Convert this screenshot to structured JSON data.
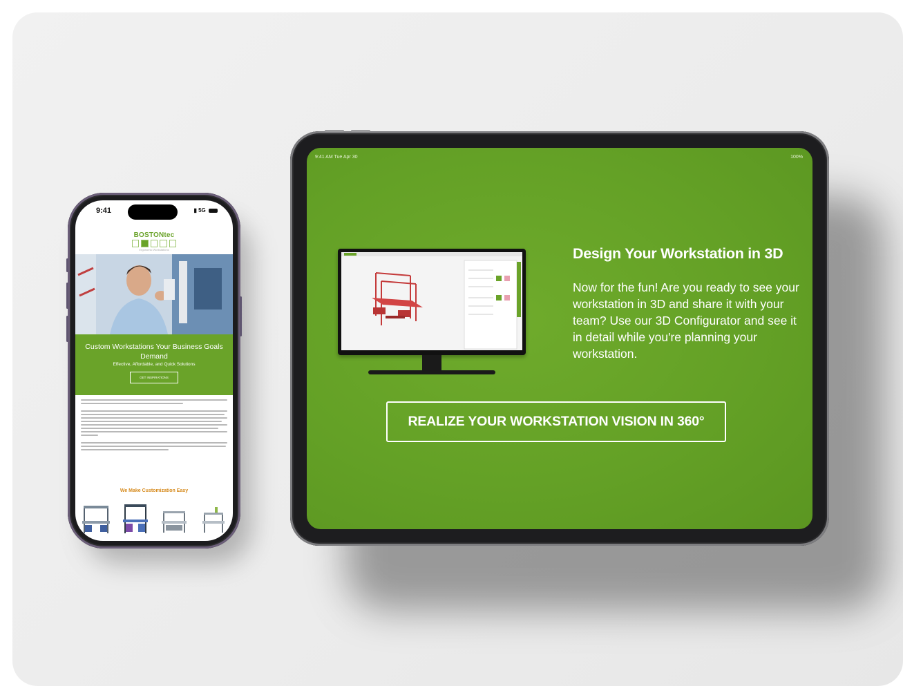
{
  "phone": {
    "status_time": "9:41",
    "status_network": "5G",
    "logo_name": "BOSTONtec",
    "logo_tagline": "Ergonomic Workstations",
    "hero_heading": "Custom Workstations Your Business Goals Demand",
    "hero_subheading": "Effective, Affordable, and Quick Solutions",
    "hero_button": "GET INSPIRATIONS",
    "section_heading": "We Make Customization Easy",
    "thumbnails": [
      "workstation-1",
      "workstation-2",
      "workstation-3",
      "workstation-4"
    ]
  },
  "tablet": {
    "status_left": "9:41 AM  Tue Apr 30",
    "status_right": "100%",
    "heading": "Design Your Workstation in 3D",
    "paragraph": "Now for the fun! Are you ready to see your workstation in 3D and share it with your team? Use our 3D Configurator and see it in detail while you're planning your workstation.",
    "cta": "REALIZE YOUR WORKSTATION VISION IN 360°"
  },
  "colors": {
    "brand_green": "#6aa329",
    "tablet_green": "#64a126",
    "accent_orange": "#d68a1c",
    "workbench_red": "#c43a3a"
  }
}
